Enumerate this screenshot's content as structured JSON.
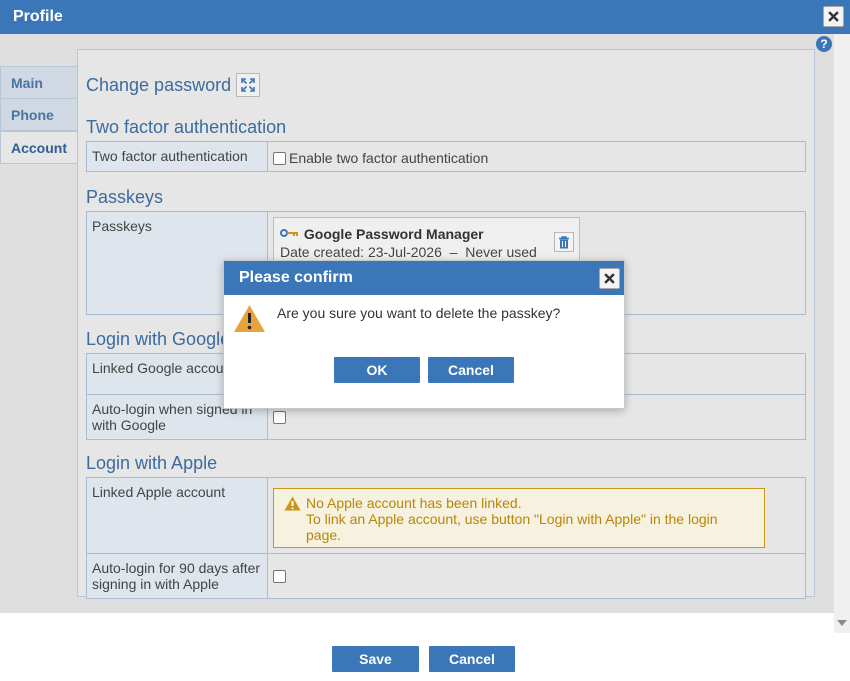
{
  "window": {
    "title": "Profile",
    "close_icon": "close-icon",
    "help_icon": "?"
  },
  "tabs": [
    {
      "label": "Main"
    },
    {
      "label": "Phone"
    },
    {
      "label": "Account",
      "active": true
    }
  ],
  "account": {
    "change_password": {
      "title": "Change password",
      "icon": "expand-icon"
    },
    "two_factor": {
      "title": "Two factor authentication",
      "row_label": "Two factor authentication",
      "checkbox_label": "Enable two factor authentication",
      "checked": false
    },
    "passkeys": {
      "title": "Passkeys",
      "row_label": "Passkeys",
      "items": [
        {
          "name": "Google Password Manager",
          "date_created": "Date created: 23-Jul-2026",
          "separator": "–",
          "usage": "Never used",
          "icon": "key-icon",
          "delete_icon": "trash-icon"
        }
      ]
    },
    "google": {
      "title": "Login with Google",
      "linked_label": "Linked Google account",
      "autologin_label": "Auto-login when signed in with Google",
      "autologin_checked": false
    },
    "apple": {
      "title": "Login with Apple",
      "linked_label": "Linked Apple account",
      "warning_line1": "No Apple account has been linked.",
      "warning_line2": "To link an Apple account, use button \"Login with Apple\" in the login page.",
      "autologin_label": "Auto-login for 90 days after signing in with Apple",
      "autologin_checked": false
    }
  },
  "footer": {
    "save_label": "Save",
    "cancel_label": "Cancel"
  },
  "confirm_dialog": {
    "title": "Please confirm",
    "message": "Are you sure you want to delete the passkey?",
    "ok_label": "OK",
    "cancel_label": "Cancel"
  },
  "colors": {
    "accent": "#3a76b8",
    "warning": "#c9961a"
  }
}
